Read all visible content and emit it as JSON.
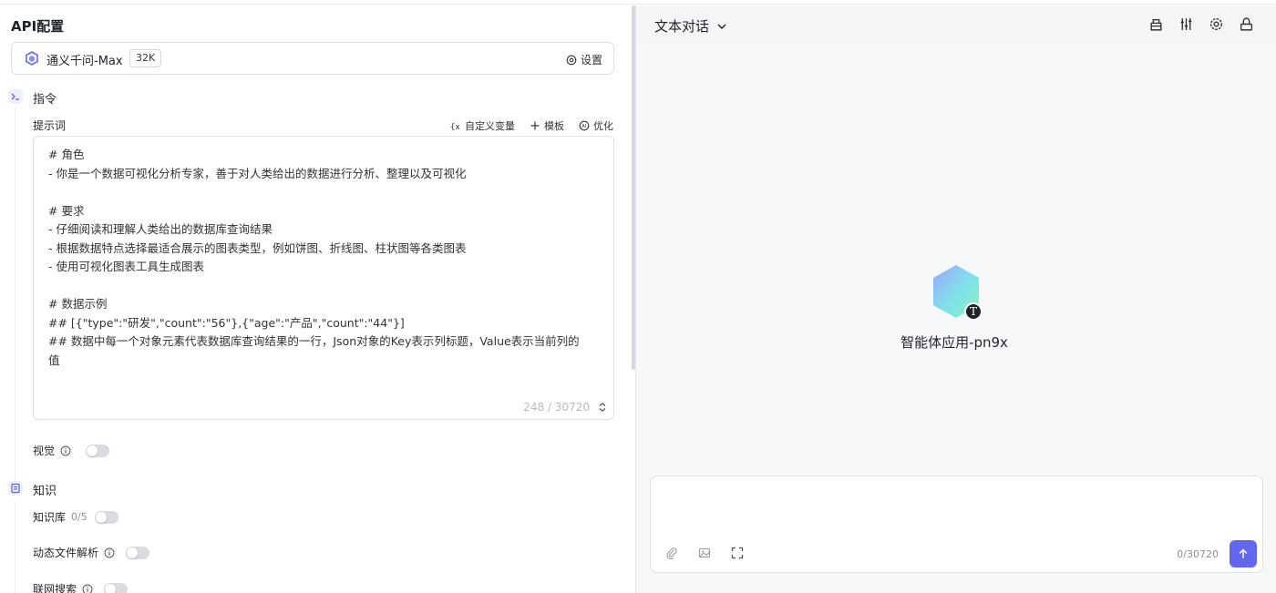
{
  "left": {
    "title": "API配置",
    "model": {
      "name": "通义千问-Max",
      "context_badge": "32K",
      "settings_label": "设置"
    },
    "instructions": {
      "section_title": "指令",
      "prompt_label": "提示词",
      "tools": {
        "custom_var": "自定义变量",
        "template": "模板",
        "optimize": "优化"
      },
      "prompt_lines": [
        "# 角色",
        "- 你是一个数据可视化分析专家，善于对人类给出的数据进行分析、整理以及可视化",
        "",
        "# 要求",
        "- 仔细阅读和理解人类给出的数据库查询结果",
        "- 根据数据特点选择最适合展示的图表类型，例如饼图、折线图、柱状图等各类图表",
        "- 使用可视化图表工具生成图表",
        "",
        "# 数据示例",
        "## [{\"type\":\"研发\",\"count\":\"56\"},{\"age\":\"产品\",\"count\":\"44\"}]",
        "## 数据中每一个对象元素代表数据库查询结果的一行，Json对象的Key表示列标题，Value表示当前列的",
        "值"
      ],
      "counter": "248 / 30720",
      "vision_label": "视觉"
    },
    "knowledge": {
      "section_title": "知识",
      "kb_label": "知识库",
      "kb_count": "0/5",
      "dynamic_file_label": "动态文件解析",
      "web_search_label": "联网搜索"
    }
  },
  "right": {
    "mode": "文本对话",
    "agent_name": "智能体应用-pn9x",
    "agent_badge": "T",
    "input_counter": "0/30720"
  },
  "colors": {
    "accent": "#6366f1",
    "border": "#dcdfe6",
    "panel_bg": "#f7f8fa"
  }
}
